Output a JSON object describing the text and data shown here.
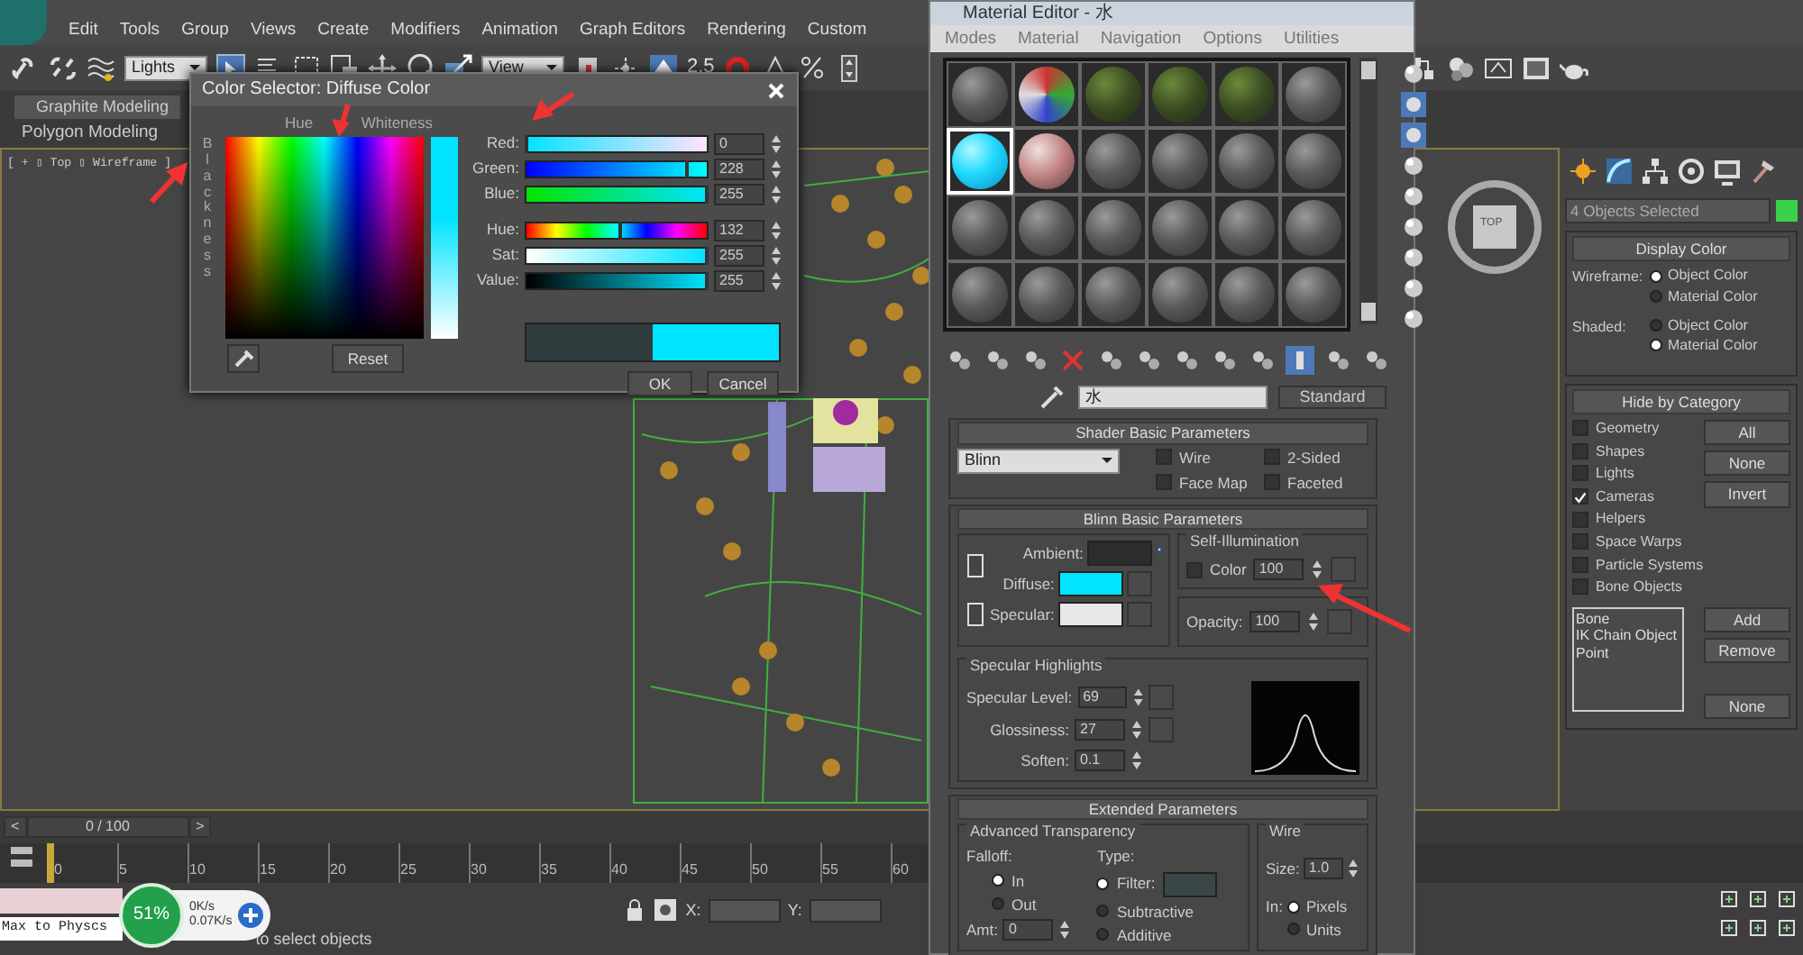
{
  "app": {
    "menu": [
      "Edit",
      "Tools",
      "Group",
      "Views",
      "Create",
      "Modifiers",
      "Animation",
      "Graph Editors",
      "Rendering",
      "Custom"
    ],
    "selection_filter": "Lights",
    "reference_coordinate": "View",
    "snap_value": "2.5",
    "ribbon_tab": "Graphite Modeling",
    "ribbon_panel": "Polygon Modeling",
    "viewport_label": "[ + ▯ Top ▯ Wireframe ]",
    "viewcube_label": "TOP"
  },
  "command_panel": {
    "selection": "4 Objects Selected",
    "display_color": {
      "title": "Display Color",
      "groups": [
        {
          "label": "Wireframe:",
          "options": [
            {
              "label": "Object Color",
              "selected": true
            },
            {
              "label": "Material Color",
              "selected": false
            }
          ]
        },
        {
          "label": "Shaded:",
          "options": [
            {
              "label": "Object Color",
              "selected": false
            },
            {
              "label": "Material Color",
              "selected": true
            }
          ]
        }
      ]
    },
    "hide_by_category": {
      "title": "Hide by Category",
      "categories": [
        {
          "label": "Geometry",
          "checked": false
        },
        {
          "label": "Shapes",
          "checked": false
        },
        {
          "label": "Lights",
          "checked": false
        },
        {
          "label": "Cameras",
          "checked": true
        },
        {
          "label": "Helpers",
          "checked": false
        },
        {
          "label": "Space Warps",
          "checked": false
        },
        {
          "label": "Particle Systems",
          "checked": false
        },
        {
          "label": "Bone Objects",
          "checked": false
        }
      ],
      "buttons": [
        "All",
        "None",
        "Invert"
      ],
      "list": [
        "Bone",
        "IK Chain Object",
        "Point"
      ],
      "list_buttons": [
        "Add",
        "Remove",
        "None"
      ]
    }
  },
  "timeline": {
    "prev": "<",
    "frame": "0 / 100",
    "next": ">",
    "ruler": [
      "0",
      "5",
      "10",
      "15",
      "20",
      "25",
      "30",
      "35",
      "40",
      "45",
      "50",
      "55",
      "60"
    ]
  },
  "status": {
    "listener": "Max to Physcs",
    "prompt": "to select objects",
    "coords": [
      "X:",
      "Y:"
    ]
  },
  "net_widget": {
    "percent": "51%",
    "upload": "0K/s",
    "download": "0.07K/s"
  },
  "color_selector": {
    "title": "Color Selector: Diffuse Color",
    "hue_label": "Hue",
    "whiteness_label": "Whiteness",
    "blackness_label": "Blackness",
    "channels": [
      {
        "label": "Red:",
        "kind": "red",
        "value": "0",
        "level": 0
      },
      {
        "label": "Green:",
        "kind": "green",
        "value": "228",
        "level": 0.894
      },
      {
        "label": "Blue:",
        "kind": "blue",
        "value": "255",
        "level": 1
      },
      {
        "label": "Hue:",
        "kind": "hue",
        "value": "132",
        "level": 0.518
      },
      {
        "label": "Sat:",
        "kind": "sat",
        "value": "255",
        "level": 1
      },
      {
        "label": "Value:",
        "kind": "value",
        "value": "255",
        "level": 1
      }
    ],
    "swatches": [
      {
        "kind": "old",
        "color": "#2f3c3e"
      },
      {
        "kind": "new",
        "color": "#00e4ff"
      }
    ],
    "buttons": {
      "reset": "Reset",
      "ok": "OK",
      "cancel": "Cancel"
    }
  },
  "material_editor": {
    "title": "Material Editor - 水",
    "menu": [
      "Modes",
      "Material",
      "Navigation",
      "Options",
      "Utilities"
    ],
    "slots": [
      {
        "kind": "plain",
        "selected": false
      },
      {
        "kind": "checker",
        "selected": false
      },
      {
        "kind": "moss",
        "selected": false
      },
      {
        "kind": "moss",
        "selected": false
      },
      {
        "kind": "moss",
        "selected": false
      },
      {
        "kind": "plain",
        "selected": false
      },
      {
        "kind": "cyan",
        "selected": true
      },
      {
        "kind": "marble",
        "selected": false
      },
      {
        "kind": "plain",
        "selected": false
      },
      {
        "kind": "plain",
        "selected": false
      },
      {
        "kind": "plain",
        "selected": false
      },
      {
        "kind": "plain",
        "selected": false
      },
      {
        "kind": "plain",
        "selected": false
      },
      {
        "kind": "plain",
        "selected": false
      },
      {
        "kind": "plain",
        "selected": false
      },
      {
        "kind": "plain",
        "selected": false
      },
      {
        "kind": "plain",
        "selected": false
      },
      {
        "kind": "plain",
        "selected": false
      },
      {
        "kind": "plain",
        "selected": false
      },
      {
        "kind": "plain",
        "selected": false
      },
      {
        "kind": "plain",
        "selected": false
      },
      {
        "kind": "plain",
        "selected": false
      },
      {
        "kind": "plain",
        "selected": false
      },
      {
        "kind": "plain",
        "selected": false
      }
    ],
    "material_name": "水",
    "material_type": "Standard",
    "shader": {
      "title": "Shader Basic Parameters",
      "shader": "Blinn",
      "options": [
        {
          "label": "Wire",
          "checked": false
        },
        {
          "label": "2-Sided",
          "checked": false
        },
        {
          "label": "Face Map",
          "checked": false
        },
        {
          "label": "Faceted",
          "checked": false
        }
      ]
    },
    "blinn": {
      "title": "Blinn Basic Parameters",
      "colors": [
        {
          "label": "Ambient:",
          "color": "#2c2c2c"
        },
        {
          "label": "Diffuse:",
          "color": "#00e4ff"
        },
        {
          "label": "Specular:",
          "color": "#e8e8e8"
        }
      ],
      "self_illum_title": "Self-Illumination",
      "self_illum_color": {
        "label": "Color",
        "checked": false
      },
      "self_illum_value": "100",
      "opacity_label": "Opacity:",
      "opacity": "100",
      "highlights_title": "Specular Highlights",
      "highlights": [
        {
          "label": "Specular Level:",
          "value": "69"
        },
        {
          "label": "Glossiness:",
          "value": "27"
        },
        {
          "label": "Soften:",
          "value": "0.1"
        }
      ]
    },
    "extended": {
      "title": "Extended Parameters",
      "transparency_title": "Advanced Transparency",
      "falloff_label": "Falloff:",
      "falloff": [
        {
          "label": "In",
          "selected": true
        },
        {
          "label": "Out",
          "selected": false
        }
      ],
      "type_label": "Type:",
      "types": [
        {
          "label": "Filter:",
          "selected": true
        },
        {
          "label": "Subtractive",
          "selected": false
        },
        {
          "label": "Additive",
          "selected": false
        }
      ],
      "amt_label": "Amt:",
      "amt": "0",
      "wire_title": "Wire",
      "size_label": "Size:",
      "size": "1.0",
      "in_label": "In:",
      "units": [
        {
          "label": "Pixels",
          "selected": true
        },
        {
          "label": "Units",
          "selected": false
        }
      ]
    }
  }
}
